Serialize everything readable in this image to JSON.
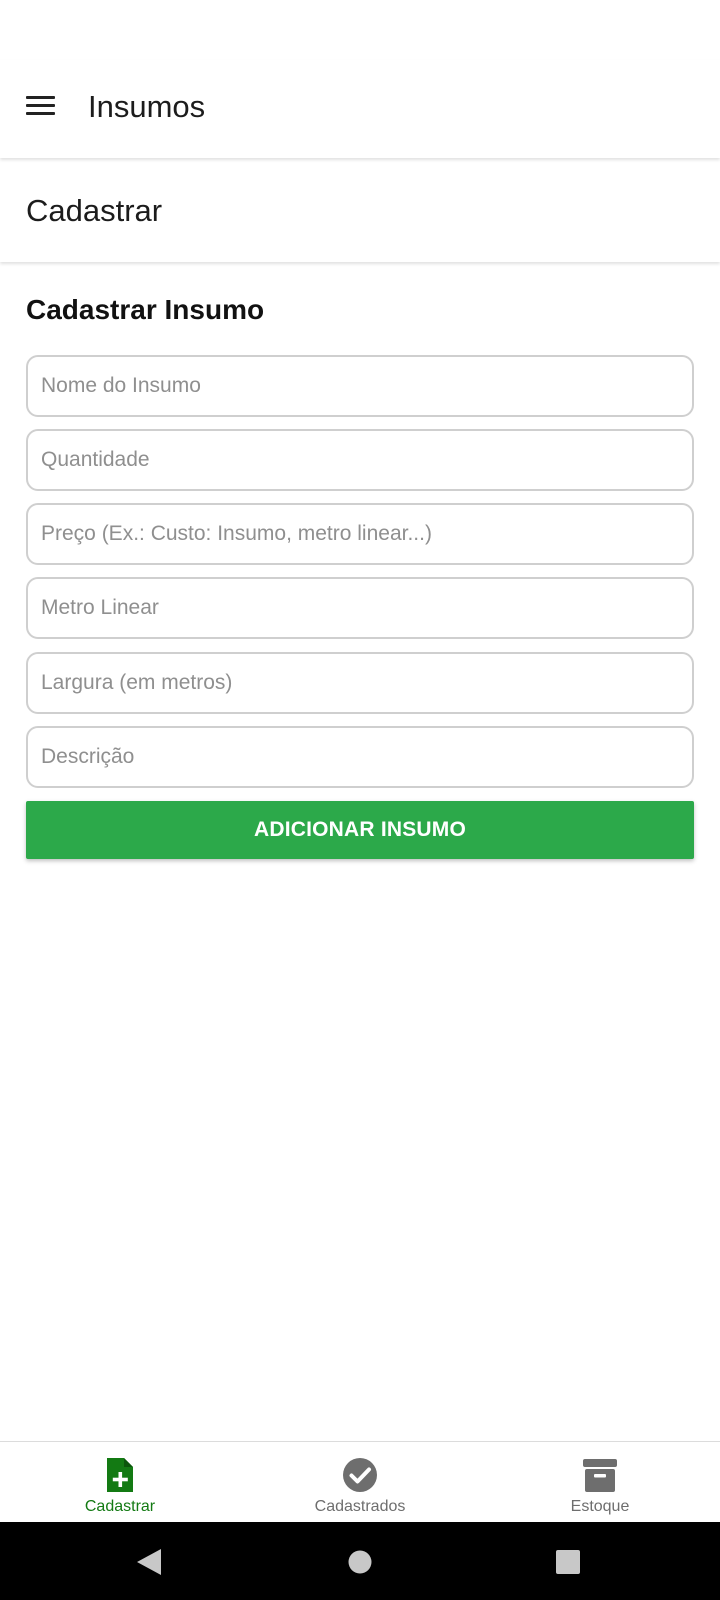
{
  "app_bar": {
    "title": "Insumos",
    "menu_icon": "hamburger-menu-icon"
  },
  "sub_header": {
    "title": "Cadastrar"
  },
  "form": {
    "title": "Cadastrar Insumo",
    "fields": [
      {
        "name": "nome",
        "value": "",
        "placeholder": "Nome do Insumo"
      },
      {
        "name": "quantidade",
        "value": "",
        "placeholder": "Quantidade"
      },
      {
        "name": "preco",
        "value": "",
        "placeholder": "Preço (Ex.: Custo: Insumo, metro linear...)"
      },
      {
        "name": "metro_linear",
        "value": "",
        "placeholder": "Metro Linear"
      },
      {
        "name": "largura",
        "value": "",
        "placeholder": "Largura (em metros)"
      },
      {
        "name": "descricao",
        "value": "",
        "placeholder": "Descrição"
      }
    ],
    "submit_label": "ADICIONAR INSUMO"
  },
  "bottom_nav": {
    "items": [
      {
        "label": "Cadastrar",
        "icon": "file-plus-icon",
        "active": true
      },
      {
        "label": "Cadastrados",
        "icon": "check-circle-icon",
        "active": false
      },
      {
        "label": "Estoque",
        "icon": "archive-box-icon",
        "active": false
      }
    ]
  },
  "system_nav": {
    "icons": [
      "back-triangle-icon",
      "home-circle-icon",
      "recents-square-icon"
    ]
  },
  "colors": {
    "accent": "#2ca94a",
    "active_nav": "#137a13",
    "inactive_nav": "#6e6e6e",
    "field_border": "#cfcfcf",
    "placeholder": "#8f8f8f"
  }
}
